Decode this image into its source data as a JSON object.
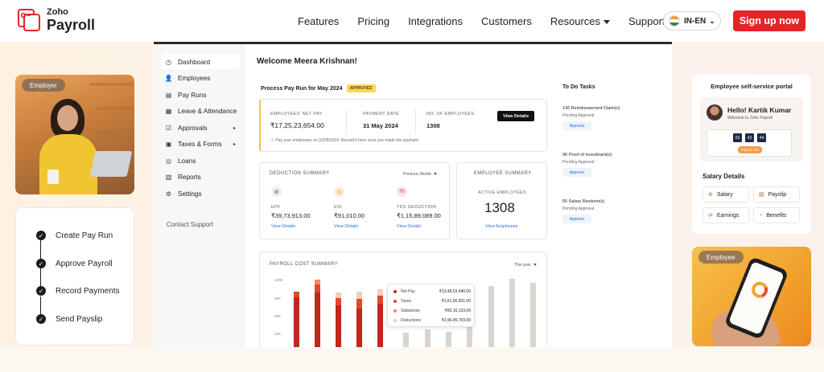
{
  "brand": {
    "line1": "Zoho",
    "line2": "Payroll"
  },
  "nav": {
    "links": [
      "Features",
      "Pricing",
      "Integrations",
      "Customers",
      "Resources",
      "Support"
    ],
    "language": "IN-EN",
    "signup": "Sign up now"
  },
  "employer_label": "Employer",
  "steps": [
    "Create Pay Run",
    "Approve Payroll",
    "Record Payments",
    "Send Payslip"
  ],
  "sidebar": {
    "items": [
      "Dashboard",
      "Employees",
      "Pay Runs",
      "Leave & Attendance",
      "Approvals",
      "Taxes & Forms",
      "Loans",
      "Reports",
      "Settings"
    ],
    "contact": "Contact Support"
  },
  "welcome": "Welcome Meera Krishnan!",
  "payrun": {
    "title": "Process Pay Run for May 2024",
    "status": "APPROVED",
    "net_pay_label": "EMPLOYEES' NET PAY",
    "net_pay": "₹17,25,23,654.00",
    "date_label": "PAYMENT DATE",
    "date": "31 May 2024",
    "count_label": "NO. OF EMPLOYEES",
    "count": "1308",
    "button": "View Details",
    "note": "Pay your employees on 31/05/2024. Record it here once you made the payment."
  },
  "deduction": {
    "title": "DEDUCTION SUMMARY",
    "period": "Previous Month",
    "items": [
      {
        "label": "EPF",
        "value": "₹39,73,913.00",
        "link": "View Details"
      },
      {
        "label": "ESI",
        "value": "₹91,010.00",
        "link": "View Details"
      },
      {
        "label": "TDS DEDUCTION",
        "value": "₹1,15,89,089.00",
        "link": "View Details"
      }
    ]
  },
  "employee_summary": {
    "title": "EMPLOYEE SUMMARY",
    "active_label": "ACTIVE EMPLOYEES",
    "active": "1308",
    "link": "View Employees"
  },
  "cost": {
    "title": "PAYROLL COST SUMMARY",
    "period": "This year",
    "y_ticks": [
      "100K",
      "80K",
      "60K",
      "20K"
    ],
    "tooltip": [
      {
        "label": "Net Pay",
        "value": "₹13,48,53,440.00",
        "color": "#c0281c"
      },
      {
        "label": "Taxes",
        "value": "₹1,51,56,551.00",
        "color": "#e04a2a"
      },
      {
        "label": "Statutories",
        "value": "₹90,16,123.00",
        "color": "#f28a5c"
      },
      {
        "label": "Deductions",
        "value": "₹2,96,45,703.00",
        "color": "#f7cdb5"
      }
    ]
  },
  "todo": {
    "title": "To Do Tasks",
    "items": [
      {
        "name": "136 Reimbursement Claim(s)",
        "status": "Pending Approval",
        "button": "Approve"
      },
      {
        "name": "96 Proof of Investment(s)",
        "status": "Pending Approval",
        "button": "Approve"
      },
      {
        "name": "55 Salary Revision(s)",
        "status": "Pending Approval",
        "button": "Approve"
      }
    ]
  },
  "ess": {
    "title": "Employee self-service portal",
    "hello": "Hello! Kartik Kumar",
    "welcome": "Welcome to Zoho Payroll",
    "clock": [
      "03",
      "43",
      "44"
    ],
    "checkout": "Check Out",
    "salary_title": "Salary Details",
    "buttons": [
      "Salary",
      "Payslip",
      "Earnings",
      "Benefits"
    ]
  },
  "employee_label": "Employee",
  "colors": {
    "brand_red": "#e42527",
    "accent_yellow": "#f0c44c",
    "link_blue": "#2a6fd8"
  }
}
